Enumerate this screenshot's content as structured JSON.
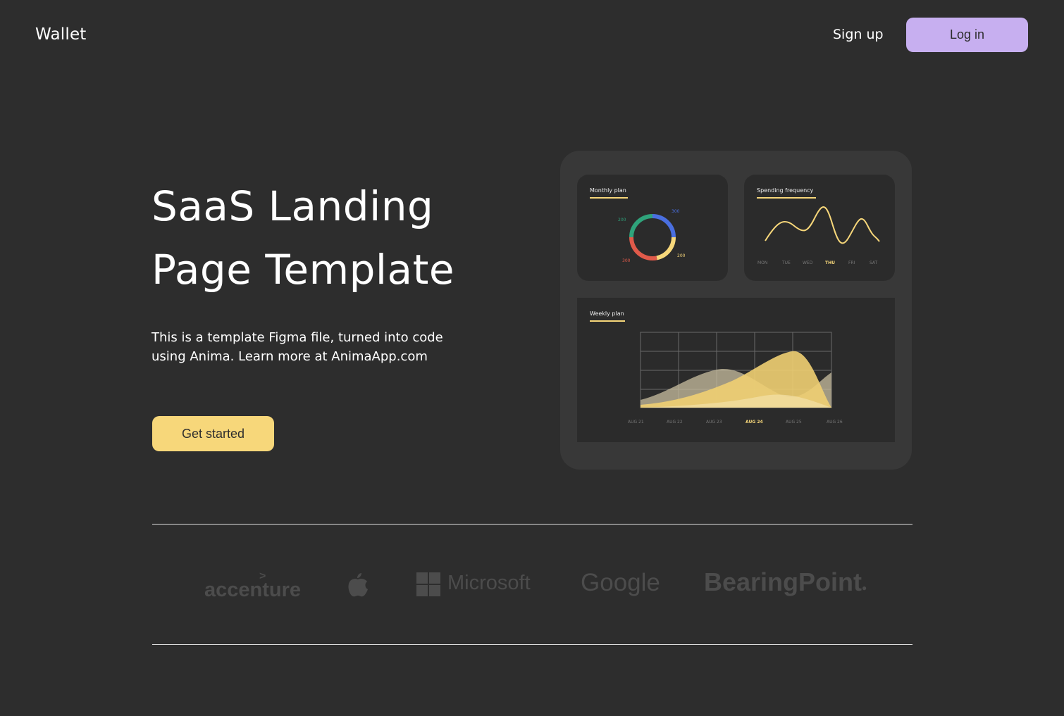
{
  "header": {
    "brand": "Wallet",
    "signup_label": "Sign up",
    "login_label": "Log in"
  },
  "hero": {
    "title_line1": "SaaS Landing",
    "title_line2": "Page Template",
    "subtitle_line1": "This is a template Figma file, turned into code",
    "subtitle_line2": "using Anima. Learn more at AnimaApp.com",
    "cta_label": "Get started"
  },
  "dashboard": {
    "monthly_plan": {
      "title": "Monthly plan",
      "labels": [
        "200",
        "300",
        "200",
        "300"
      ]
    },
    "spending_frequency": {
      "title": "Spending frequency",
      "days": [
        "MON",
        "TUE",
        "WED",
        "THU",
        "FRI",
        "SAT"
      ],
      "active_day": "THU"
    },
    "weekly_plan": {
      "title": "Weekly plan",
      "days": [
        "AUG 21",
        "AUG 22",
        "AUG 23",
        "AUG 24",
        "AUG 25",
        "AUG 26"
      ],
      "active_day": "AUG 24"
    }
  },
  "logos": {
    "accenture": "accenture",
    "apple": "apple-logo",
    "microsoft": "Microsoft",
    "google": "Google",
    "bearingpoint": "BearingPoint"
  },
  "colors": {
    "background": "#2d2d2d",
    "accent_yellow": "#f7d77a",
    "accent_purple": "#c7aff0",
    "donut_blue": "#4a6fe0",
    "donut_green": "#2fa37b",
    "donut_red": "#e05a4a",
    "donut_yellow": "#f7d77a"
  }
}
